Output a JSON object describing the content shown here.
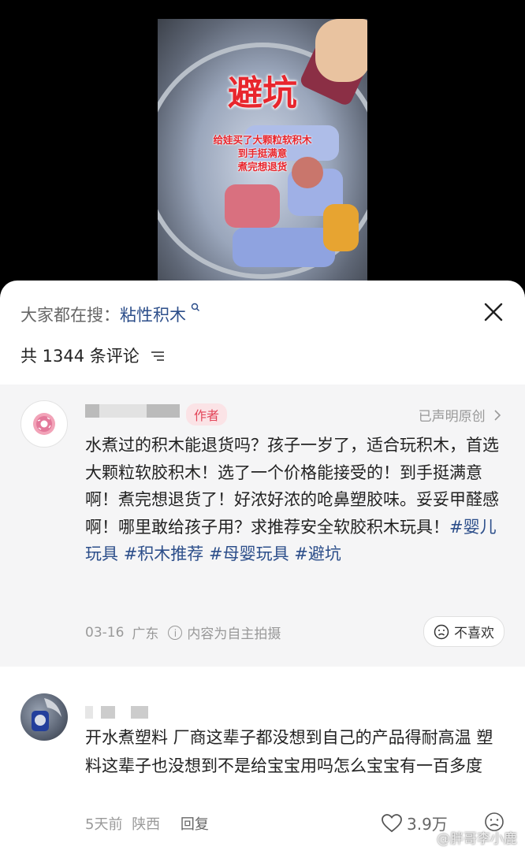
{
  "video": {
    "overlay_title": "避坑",
    "overlay_caption_lines": [
      "给娃买了大颗粒软积木",
      "到手挺满意",
      "煮完想退货"
    ]
  },
  "search": {
    "prefix": "大家都在搜：",
    "keyword": "粘性积木",
    "icon": "search-icon"
  },
  "comments_header": {
    "count_text": "共 1344 条评论"
  },
  "main_comment": {
    "author_badge": "作者",
    "declared": "已声明原创",
    "text_plain": "水煮过的积木能退货吗？孩子一岁了，适合玩积木，首选大颗粒软胶积木！选了一个价格能接受的！到手挺满意啊！煮完想退货了！好浓好浓的呛鼻塑胶味。妥妥甲醛感啊！哪里敢给孩子用？求推荐安全软胶积木玩具！",
    "tags": [
      "#婴儿玩具",
      "#积木推荐",
      "#母婴玩具",
      "#避坑"
    ],
    "date": "03-16",
    "location": "广东",
    "content_note": "内容为自主拍摄",
    "dislike_label": "不喜欢"
  },
  "reply_comment": {
    "text": "开水煮塑料 厂商这辈子都没想到自己的产品得耐高温 塑料这辈子也没想到不是给宝宝用吗怎么宝宝有一百多度",
    "time": "5天前",
    "location": "陕西",
    "reply_label": "回复",
    "likes": "3.9万"
  },
  "watermark": "@胖哥李小鹿",
  "colors": {
    "accent_link": "#2c4e8a",
    "author_badge": "#e3465a",
    "overlay_red": "#e8262d"
  }
}
